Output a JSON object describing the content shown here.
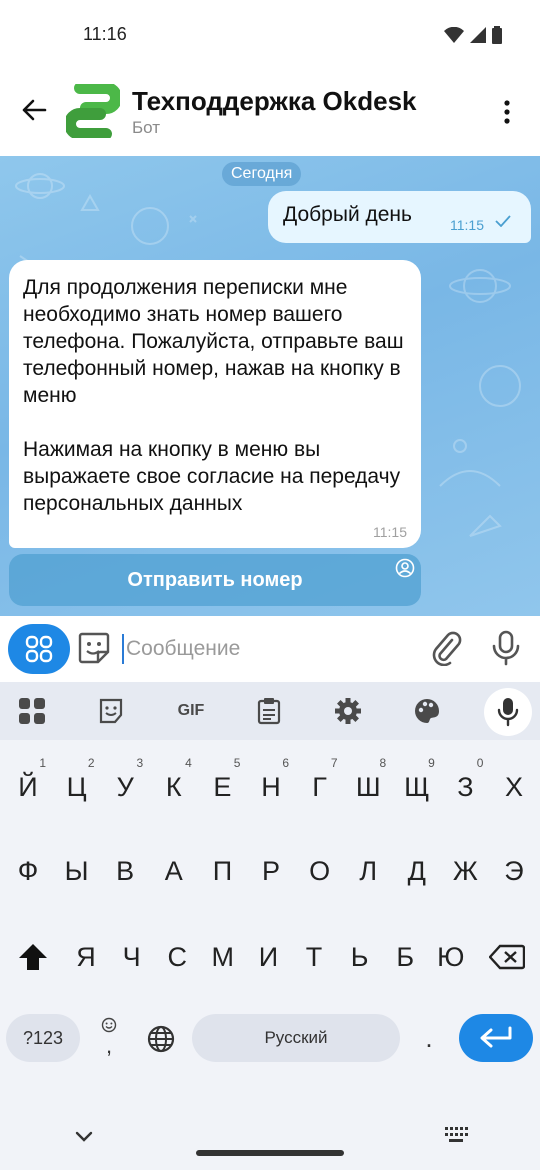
{
  "status_bar": {
    "time": "11:16"
  },
  "header": {
    "title": "Техподдержка Okdesk",
    "subtitle": "Бот"
  },
  "chat": {
    "date_label": "Сегодня",
    "outgoing": {
      "text": "Добрый день",
      "time": "11:15"
    },
    "incoming": {
      "text": "Для продолжения переписки мне необходимо знать номер вашего телефона. Пожалуйста, отправьте ваш телефонный номер, нажав на кнопку в меню\n\nНажимая на кнопку в меню вы выражаете свое согласие на передачу персональных данных",
      "time": "11:15"
    },
    "send_number_button": "Отправить номер"
  },
  "composer": {
    "placeholder": "Сообщение"
  },
  "keyboard": {
    "toolbar_gif": "GIF",
    "row1": [
      "Й",
      "Ц",
      "У",
      "К",
      "Е",
      "Н",
      "Г",
      "Ш",
      "Щ",
      "З",
      "Х"
    ],
    "row1_hints": [
      "1",
      "2",
      "3",
      "4",
      "5",
      "6",
      "7",
      "8",
      "9",
      "0",
      ""
    ],
    "row2": [
      "Ф",
      "Ы",
      "В",
      "А",
      "П",
      "Р",
      "О",
      "Л",
      "Д",
      "Ж",
      "Э"
    ],
    "row3": [
      "Я",
      "Ч",
      "С",
      "М",
      "И",
      "Т",
      "Ь",
      "Б",
      "Ю"
    ],
    "num_key": "?123",
    "comma": ",",
    "space_label": "Русский",
    "period": "."
  },
  "colors": {
    "accent": "#1e88e5",
    "chat_bg": "#84bfe9",
    "out_bubble": "#e6f6ff"
  }
}
